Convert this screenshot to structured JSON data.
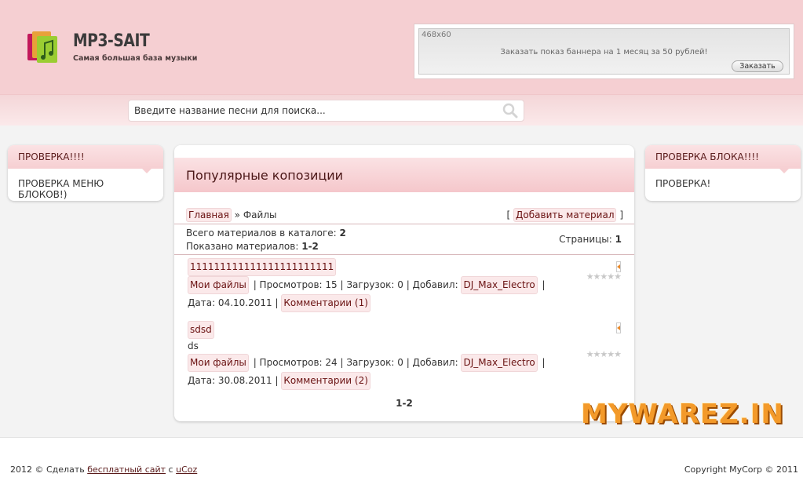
{
  "header": {
    "site_title": "MP3-SAIT",
    "site_subtitle": "Самая большая база музыки",
    "banner": {
      "size_label": "468x60",
      "text": "Заказать показ баннера на 1 месяц за 50 рублей!",
      "button_label": "Заказать"
    }
  },
  "search": {
    "placeholder": "Введите название песни для поиска..."
  },
  "left_block": {
    "title": "ПРОВЕРКА!!!!",
    "body": "ПРОВЕРКА МЕНЮ БЛОКОВ!)"
  },
  "right_block": {
    "title": "ПРОВЕРКА БЛОКА!!!!",
    "body": "ПРОВЕРКА!"
  },
  "main": {
    "title": "Популярные копозиции",
    "breadcrumb": {
      "home": "Главная",
      "separator": "»",
      "current": "Файлы"
    },
    "add_material": "Добавить материал",
    "add_open": "[",
    "add_close": "]",
    "stats": {
      "total_label": "Всего материалов в каталоге:",
      "total_value": "2",
      "shown_label": "Показано материалов:",
      "shown_value": "1-2",
      "pages_label": "Страницы:",
      "pages_value": "1"
    },
    "entries": [
      {
        "title": "111111111111111111111111",
        "description": "",
        "category": "Мои файлы",
        "views": "| Просмотров: 15 | Загрузок: 0 | Добавил:",
        "author": "DJ_Max_Electro",
        "trail": "|",
        "date": "Дата: 04.10.2011 |",
        "comments": "Комментарии (1)"
      },
      {
        "title": "sdsd",
        "description": "ds",
        "category": "Мои файлы",
        "views": "| Просмотров: 24 | Загрузок: 0 | Добавил:",
        "author": "DJ_Max_Electro",
        "trail": "|",
        "date": "Дата: 30.08.2011 |",
        "comments": "Комментарии (2)"
      }
    ],
    "pager": "1-2",
    "rating_stars": "★★★★★"
  },
  "watermark": "MYWAREZ.IN",
  "footer": {
    "left_prefix": "2012 © Сделать",
    "left_link": "бесплатный сайт",
    "left_mid": "с",
    "left_link2": "uCoz",
    "right": "Copyright MyCorp © 2011"
  },
  "colors": {
    "header_bg": "#f5cfd2",
    "link": "#6a1212",
    "watermark": "#f39a2a"
  }
}
